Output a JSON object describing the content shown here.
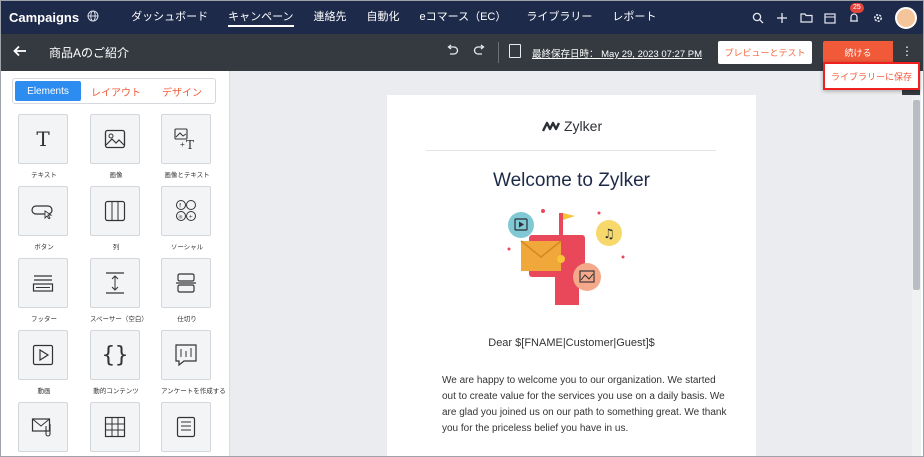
{
  "topnav": {
    "brand": "Campaigns",
    "items": [
      "ダッシュボード",
      "キャンペーン",
      "連絡先",
      "自動化",
      "eコマース（EC）",
      "ライブラリー",
      "レポート"
    ],
    "active_index": 1,
    "notification_count": "25"
  },
  "editor": {
    "title": "商品Aのご紹介",
    "last_saved": "最終保存日時： May 29, 2023 07:27 PM",
    "preview_label": "プレビューとテスト",
    "continue_label": "続ける",
    "dropdown_item": "ライブラリーに保存"
  },
  "panel": {
    "tabs": [
      "Elements",
      "レイアウト",
      "デザイン"
    ],
    "active_tab": 0,
    "elements": [
      {
        "label": "テキスト",
        "icon": "text-icon"
      },
      {
        "label": "画像",
        "icon": "image-icon"
      },
      {
        "label": "画像とテキスト",
        "icon": "image-text-icon"
      },
      {
        "label": "ボタン",
        "icon": "button-icon"
      },
      {
        "label": "列",
        "icon": "columns-icon"
      },
      {
        "label": "ソーシャル",
        "icon": "social-icon"
      },
      {
        "label": "フッター",
        "icon": "footer-icon"
      },
      {
        "label": "スペーサー（空白）",
        "icon": "spacer-icon"
      },
      {
        "label": "仕切り",
        "icon": "divider-icon"
      },
      {
        "label": "動画",
        "icon": "video-icon"
      },
      {
        "label": "動的コンテンツ",
        "icon": "dynamic-content-icon"
      },
      {
        "label": "アンケートを作成する",
        "icon": "survey-icon"
      },
      {
        "label": "",
        "icon": "attachment-mail-icon"
      },
      {
        "label": "",
        "icon": "table-icon"
      },
      {
        "label": "",
        "icon": "document-icon"
      }
    ]
  },
  "email": {
    "logo_text": "Zylker",
    "heading": "Welcome to Zylker",
    "greeting": "Dear $[FNAME|Customer|Guest]$",
    "body": "We are happy to welcome you to our organization. We started out to create value for the services you use on a daily basis. We are glad you joined us on our path to something great. We thank you for the priceless belief you have in us."
  },
  "colors": {
    "nav_bg": "#1e2a4a",
    "editbar_bg": "#343a40",
    "accent_orange": "#f05a39",
    "tab_blue": "#2d8cf0",
    "highlight_red": "#ee2020"
  }
}
